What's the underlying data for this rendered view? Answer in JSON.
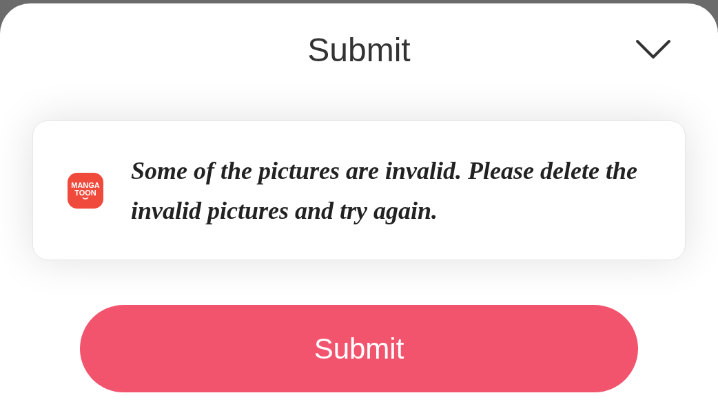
{
  "sheet": {
    "title": "Submit"
  },
  "toast": {
    "logo_text": [
      "MANGA",
      "TOON"
    ],
    "message": "Some of the pictures are invalid.  Please delete the invalid pictures and try again."
  },
  "submit_button": {
    "label": "Submit"
  }
}
